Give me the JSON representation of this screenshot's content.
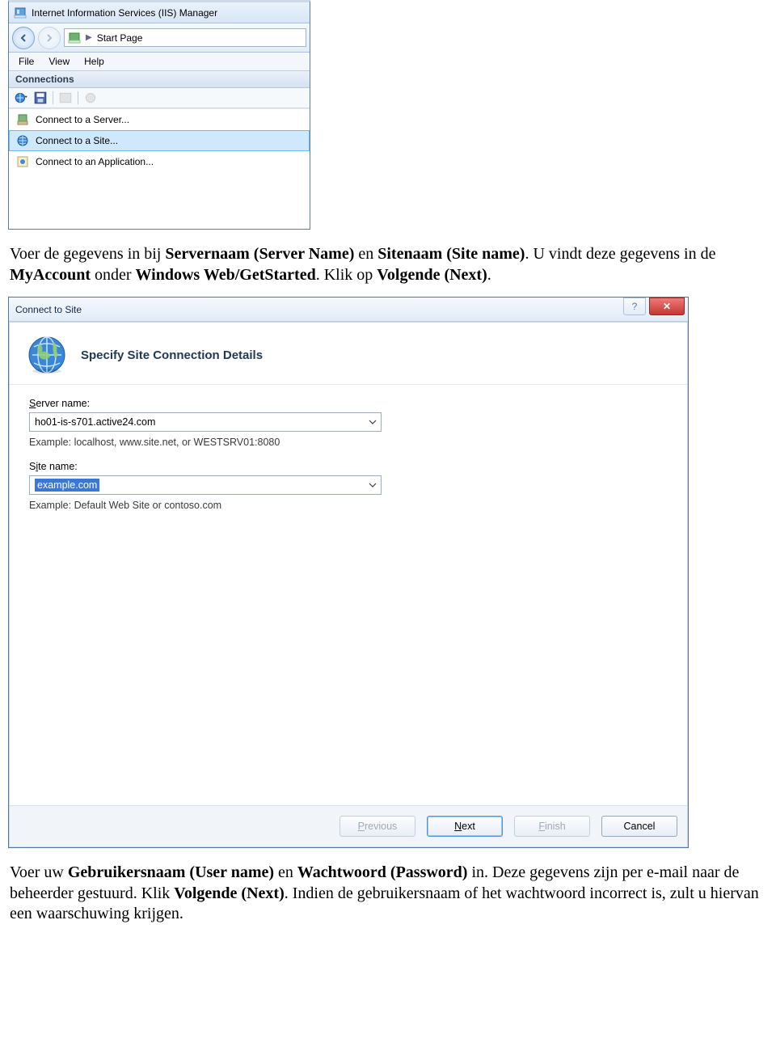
{
  "iis": {
    "title": "Internet Information Services (IIS) Manager",
    "breadcrumb_sep": "▶",
    "breadcrumb": "Start Page",
    "menus": {
      "file": "File",
      "view": "View",
      "help": "Help"
    },
    "panel": "Connections",
    "menu_items": {
      "server": "Connect to a Server...",
      "site": "Connect to a Site...",
      "app": "Connect to an Application..."
    }
  },
  "para1": {
    "t1": "Voer de gegevens in bij ",
    "b1": "Servernaam (Server Name)",
    "t2": " en ",
    "b2": "Sitenaam (Site name)",
    "t3": ". U vindt deze gegevens in de ",
    "b3": "MyAccount",
    "t4": " onder ",
    "b4": "Windows Web/GetStarted",
    "t5": ". Klik op ",
    "b5": "Volgende (Next)",
    "t6": "."
  },
  "dialog": {
    "title": "Connect to Site",
    "heading": "Specify Site Connection Details",
    "server_label_pre": "S",
    "server_label_post": "erver name:",
    "server_value": "ho01-is-s701.active24.com",
    "server_example": "Example: localhost, www.site.net, or WESTSRV01:8080",
    "site_label_pre": "S",
    "site_label_post": "ite name:",
    "site_value": "example.com",
    "site_example": "Example: Default Web Site or contoso.com",
    "buttons": {
      "previous": "Previous",
      "next": "Next",
      "finish": "Finish",
      "cancel": "Cancel"
    },
    "help_glyph": "?",
    "close_glyph": "✕"
  },
  "para2": {
    "t1": "Voer uw ",
    "b1": "Gebruikersnaam (User name)",
    "t2": " en ",
    "b2": "Wachtwoord (Password)",
    "t3": " in. Deze gegevens zijn per e-mail naar de beheerder gestuurd. Klik ",
    "b3": "Volgende (Next)",
    "t4": ". Indien de gebruikersnaam of het wachtwoord incorrect is, zult u hiervan een waarschuwing krijgen."
  }
}
